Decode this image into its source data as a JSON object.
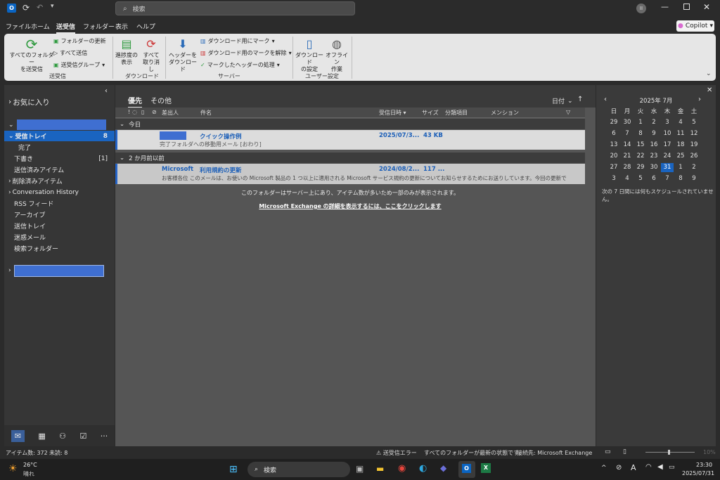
{
  "titlebar": {
    "search_placeholder": "検索"
  },
  "menu": {
    "items": [
      "ファイル",
      "ホーム",
      "送受信",
      "フォルダー",
      "表示",
      "ヘルプ"
    ],
    "active": "送受信",
    "copilot": "Copilot"
  },
  "ribbon": {
    "send_all": "すべてのフォルダー\nを送受信",
    "update_folder": "フォルダーの更新",
    "send_all_small": "すべて送信",
    "send_groups": "送受信グループ",
    "group1": "送受信",
    "show_progress": "進捗度の\n表示",
    "cancel_all": "すべて\n取り消し",
    "group2": "ダウンロード",
    "download_headers": "ヘッダーを\nダウンロード",
    "mark_download": "ダウンロード用にマーク",
    "unmark_download": "ダウンロード用のマークを解除",
    "process_marked": "マークしたヘッダーの処理",
    "group3": "サーバー",
    "download_settings": "ダウンロード\nの設定",
    "offline": "オフライン\n作業",
    "group4": "ユーザー設定"
  },
  "folders": {
    "favorites": "お気に入り",
    "inbox": "受信トレイ",
    "inbox_count": "8",
    "done": "完了",
    "drafts": "下書き",
    "drafts_count": "[1]",
    "sent": "送信済みアイテム",
    "deleted": "削除済みアイテム",
    "conversation": "Conversation History",
    "rss": "RSS フィード",
    "archive": "アーカイブ",
    "outbox": "送信トレイ",
    "junk": "迷惑メール",
    "search": "検索フォルダー"
  },
  "maillist": {
    "tab_focused": "優先",
    "tab_other": "その他",
    "sort": "日付",
    "columns": {
      "from": "差出人",
      "subject": "件名",
      "received": "受信日時",
      "size": "サイズ",
      "category": "分類項目",
      "mention": "メンション"
    },
    "group_today": "今日",
    "group_old": "2 か月前以前",
    "mail1": {
      "subject": "クイック操作例",
      "preview": "完了フォルダへの移動用メール [おわり]",
      "date": "2025/07/3...",
      "size": "43 KB"
    },
    "mail2": {
      "from": "Microsoft",
      "subject": "利用規約の更新",
      "preview": "お客様各位 このメールは、お使いの Microsoft 製品の 1 つ以上に適用される Microsoft サービス規約の更新についてお知らせするためにお送りしています。今回の更新で",
      "date": "2024/08/2...",
      "size": "117 ..."
    },
    "notice": "このフォルダーはサーバー上にあり、アイテム数が多いため一部のみが表示されます。",
    "link": "Microsoft Exchange の詳細を表示するには、ここをクリックします"
  },
  "calendar": {
    "month": "2025年 7月",
    "weekdays": [
      "日",
      "月",
      "火",
      "水",
      "木",
      "金",
      "土"
    ],
    "weeks": [
      [
        "29",
        "30",
        "1",
        "2",
        "3",
        "4",
        "5"
      ],
      [
        "6",
        "7",
        "8",
        "9",
        "10",
        "11",
        "12"
      ],
      [
        "13",
        "14",
        "15",
        "16",
        "17",
        "18",
        "19"
      ],
      [
        "20",
        "21",
        "22",
        "23",
        "24",
        "25",
        "26"
      ],
      [
        "27",
        "28",
        "29",
        "30",
        "31",
        "1",
        "2"
      ],
      [
        "3",
        "4",
        "5",
        "6",
        "7",
        "8",
        "9"
      ]
    ],
    "today": "31",
    "note": "次の 7 日間には何もスケジュールされていません。"
  },
  "status": {
    "items": "アイテム数: 372",
    "unread": "未読: 8",
    "error": "送受信エラー",
    "uptodate": "すべてのフォルダーが最新の状態です。",
    "connected": "接続先: Microsoft Exchange",
    "zoom": "10%"
  },
  "taskbar": {
    "temp": "26°C",
    "weather": "晴れ",
    "search": "検索",
    "time": "23:30",
    "date": "2025/07/31"
  },
  "colors": {
    "accent": "#2564c8",
    "redacted": "#3f6fd1",
    "selected_row": "#d9d9d9"
  }
}
